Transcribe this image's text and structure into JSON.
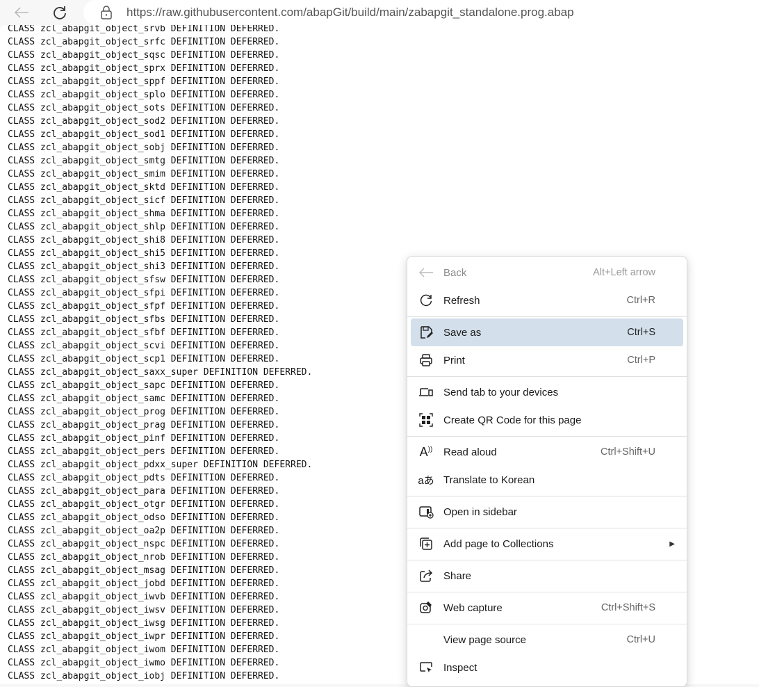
{
  "browser": {
    "url": "https://raw.githubusercontent.com/abapGit/build/main/zabapgit_standalone.prog.abap"
  },
  "code_lines": [
    "CLASS zcl_abapgit_object_srvb DEFINITION DEFERRED.",
    "CLASS zcl_abapgit_object_srfc DEFINITION DEFERRED.",
    "CLASS zcl_abapgit_object_sqsc DEFINITION DEFERRED.",
    "CLASS zcl_abapgit_object_sprx DEFINITION DEFERRED.",
    "CLASS zcl_abapgit_object_sppf DEFINITION DEFERRED.",
    "CLASS zcl_abapgit_object_splo DEFINITION DEFERRED.",
    "CLASS zcl_abapgit_object_sots DEFINITION DEFERRED.",
    "CLASS zcl_abapgit_object_sod2 DEFINITION DEFERRED.",
    "CLASS zcl_abapgit_object_sod1 DEFINITION DEFERRED.",
    "CLASS zcl_abapgit_object_sobj DEFINITION DEFERRED.",
    "CLASS zcl_abapgit_object_smtg DEFINITION DEFERRED.",
    "CLASS zcl_abapgit_object_smim DEFINITION DEFERRED.",
    "CLASS zcl_abapgit_object_sktd DEFINITION DEFERRED.",
    "CLASS zcl_abapgit_object_sicf DEFINITION DEFERRED.",
    "CLASS zcl_abapgit_object_shma DEFINITION DEFERRED.",
    "CLASS zcl_abapgit_object_shlp DEFINITION DEFERRED.",
    "CLASS zcl_abapgit_object_shi8 DEFINITION DEFERRED.",
    "CLASS zcl_abapgit_object_shi5 DEFINITION DEFERRED.",
    "CLASS zcl_abapgit_object_shi3 DEFINITION DEFERRED.",
    "CLASS zcl_abapgit_object_sfsw DEFINITION DEFERRED.",
    "CLASS zcl_abapgit_object_sfpi DEFINITION DEFERRED.",
    "CLASS zcl_abapgit_object_sfpf DEFINITION DEFERRED.",
    "CLASS zcl_abapgit_object_sfbs DEFINITION DEFERRED.",
    "CLASS zcl_abapgit_object_sfbf DEFINITION DEFERRED.",
    "CLASS zcl_abapgit_object_scvi DEFINITION DEFERRED.",
    "CLASS zcl_abapgit_object_scp1 DEFINITION DEFERRED.",
    "CLASS zcl_abapgit_object_saxx_super DEFINITION DEFERRED.",
    "CLASS zcl_abapgit_object_sapc DEFINITION DEFERRED.",
    "CLASS zcl_abapgit_object_samc DEFINITION DEFERRED.",
    "CLASS zcl_abapgit_object_prog DEFINITION DEFERRED.",
    "CLASS zcl_abapgit_object_prag DEFINITION DEFERRED.",
    "CLASS zcl_abapgit_object_pinf DEFINITION DEFERRED.",
    "CLASS zcl_abapgit_object_pers DEFINITION DEFERRED.",
    "CLASS zcl_abapgit_object_pdxx_super DEFINITION DEFERRED.",
    "CLASS zcl_abapgit_object_pdts DEFINITION DEFERRED.",
    "CLASS zcl_abapgit_object_para DEFINITION DEFERRED.",
    "CLASS zcl_abapgit_object_otgr DEFINITION DEFERRED.",
    "CLASS zcl_abapgit_object_odso DEFINITION DEFERRED.",
    "CLASS zcl_abapgit_object_oa2p DEFINITION DEFERRED.",
    "CLASS zcl_abapgit_object_nspc DEFINITION DEFERRED.",
    "CLASS zcl_abapgit_object_nrob DEFINITION DEFERRED.",
    "CLASS zcl_abapgit_object_msag DEFINITION DEFERRED.",
    "CLASS zcl_abapgit_object_jobd DEFINITION DEFERRED.",
    "CLASS zcl_abapgit_object_iwvb DEFINITION DEFERRED.",
    "CLASS zcl_abapgit_object_iwsv DEFINITION DEFERRED.",
    "CLASS zcl_abapgit_object_iwsg DEFINITION DEFERRED.",
    "CLASS zcl_abapgit_object_iwpr DEFINITION DEFERRED.",
    "CLASS zcl_abapgit_object_iwom DEFINITION DEFERRED.",
    "CLASS zcl_abapgit_object_iwmo DEFINITION DEFERRED.",
    "CLASS zcl_abapgit_object_iobj DEFINITION DEFERRED."
  ],
  "menu": {
    "back": {
      "label": "Back",
      "shortcut": "Alt+Left arrow"
    },
    "refresh": {
      "label": "Refresh",
      "shortcut": "Ctrl+R"
    },
    "save_as": {
      "label": "Save as",
      "shortcut": "Ctrl+S"
    },
    "print": {
      "label": "Print",
      "shortcut": "Ctrl+P"
    },
    "send_tab": {
      "label": "Send tab to your devices"
    },
    "qr": {
      "label": "Create QR Code for this page"
    },
    "read_aloud": {
      "label": "Read aloud",
      "shortcut": "Ctrl+Shift+U"
    },
    "translate": {
      "label": "Translate to Korean"
    },
    "sidebar": {
      "label": "Open in sidebar"
    },
    "collections": {
      "label": "Add page to Collections"
    },
    "share": {
      "label": "Share"
    },
    "web_capture": {
      "label": "Web capture",
      "shortcut": "Ctrl+Shift+S"
    },
    "view_source": {
      "label": "View page source",
      "shortcut": "Ctrl+U"
    },
    "inspect": {
      "label": "Inspect"
    }
  }
}
